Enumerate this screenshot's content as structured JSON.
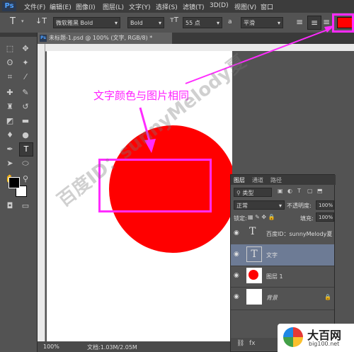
{
  "app": {
    "logo": "Ps",
    "menus": [
      "文件(F)",
      "编辑(E)",
      "图像(I)",
      "图层(L)",
      "文字(Y)",
      "选择(S)",
      "滤镜(T)",
      "3D(D)",
      "视图(V)",
      "窗口"
    ]
  },
  "options": {
    "font_family": "微软雅黑 Bold",
    "font_style": "Bold",
    "font_size": "55 点",
    "aa_label": "a",
    "aa_mode": "平滑",
    "text_color": "#ff0000"
  },
  "document": {
    "tab_title": "未标题-1.psd @ 100% (文字, RGB/8) *",
    "status_zoom": "100%",
    "status_doc": "文档:1.03M/2.05M"
  },
  "layers_panel": {
    "tabs": [
      "图层",
      "通道",
      "路径"
    ],
    "filter_label": "类型",
    "blend_mode": "正常",
    "opacity_label": "不透明度:",
    "opacity_value": "100%",
    "lock_label": "锁定:",
    "fill_label": "填充:",
    "fill_value": "100%",
    "layers": [
      {
        "name": "百度ID：sunnyMelody夏",
        "kind": "text"
      },
      {
        "name": "文字",
        "kind": "text"
      },
      {
        "name": "图层 1",
        "kind": "shape"
      },
      {
        "name": "背景",
        "kind": "background"
      }
    ]
  },
  "annotation": {
    "note": "文字颜色与图片相同"
  },
  "watermark": {
    "text": "百度ID：sunnyMelody夏"
  },
  "site_logo": {
    "name": "大百网",
    "url": "big100.net"
  },
  "colors": {
    "fill_red": "#ff0000",
    "annotation": "#ff2bff"
  }
}
